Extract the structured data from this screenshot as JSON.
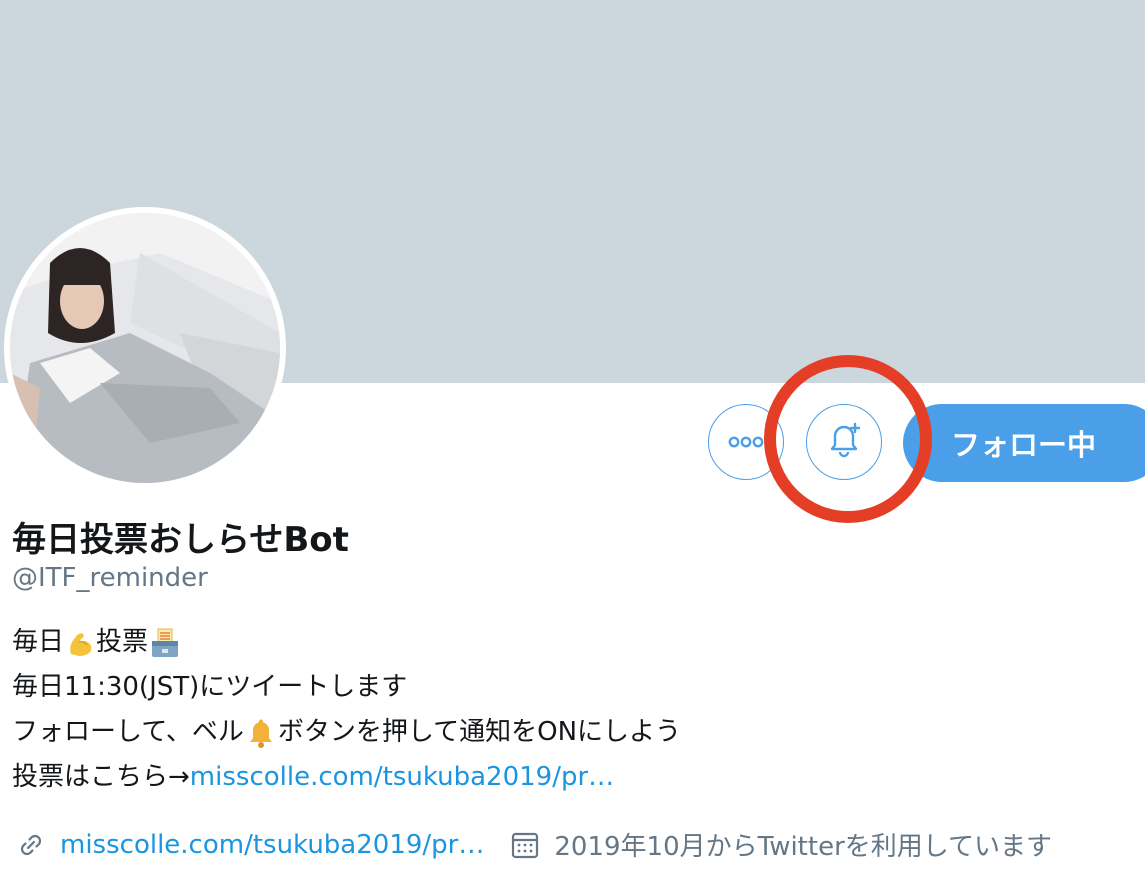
{
  "profile": {
    "display_name": "毎日投票おしらせBot",
    "handle": "@ITF_reminder",
    "bio": {
      "line1_a": "毎日",
      "line1_b": "投票",
      "line2": "毎日11:30(JST)にツイートします",
      "line3_a": "フォローして、ベル",
      "line3_b": "ボタンを押して通知をONにしよう",
      "line4_prefix": "投票はこちら→",
      "line4_link": "misscolle.com/tsukuba2019/pr…"
    },
    "website_link": "misscolle.com/tsukuba2019/pr…",
    "joined": "2019年10月からTwitterを利用しています"
  },
  "actions": {
    "follow_label": "フォロー中"
  },
  "icons": {
    "more": "more-dots-icon",
    "bell": "bell-plus-icon",
    "link": "link-icon",
    "calendar": "calendar-icon",
    "flexed_biceps": "flexed-biceps-emoji",
    "ballot_box": "ballot-box-emoji",
    "bell_emoji": "bell-emoji"
  },
  "colors": {
    "banner": "#ccd6dd",
    "accent": "#4a9fe8",
    "link": "#1b95e0",
    "secondary_text": "#657786",
    "highlight_ring": "#e43e27"
  }
}
